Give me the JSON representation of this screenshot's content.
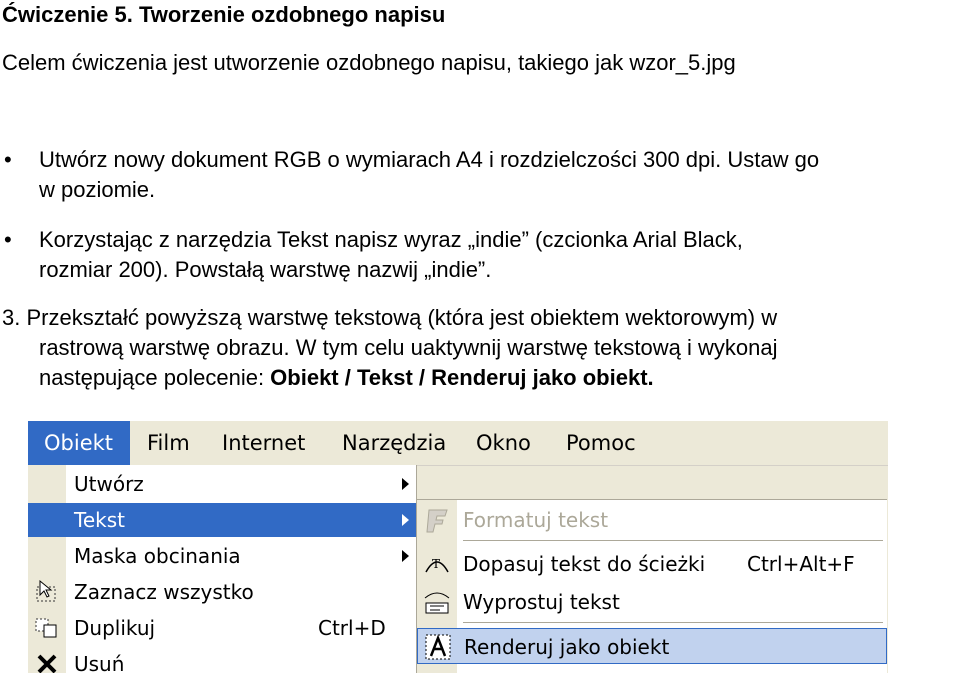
{
  "document": {
    "title": "Ćwiczenie 5. Tworzenie ozdobnego napisu",
    "intro": "Celem ćwiczenia jest utworzenie ozdobnego napisu, takiego jak wzor_5.jpg",
    "bullets": [
      {
        "line1": "Utwórz nowy dokument RGB o wymiarach A4 i rozdzielczości 300 dpi. Ustaw go",
        "line2": "w poziomie."
      },
      {
        "line1": "Korzystając z narzędzia Tekst napisz wyraz „indie” (czcionka Arial Black,",
        "line2": "rozmiar 200). Powstałą warstwę nazwij „indie”."
      }
    ],
    "bullet_char": "•",
    "step3": {
      "line1": "3. Przekształć powyższą warstwę tekstową (która jest obiektem wektorowym) w",
      "line2": "rastrową warstwę obrazu. W tym celu uaktywnij warstwę tekstową i wykonaj",
      "line3_prefix": "następujące polecenie: ",
      "line3_bold": "Obiekt / Tekst / Renderuj jako obiekt."
    }
  },
  "screenshot": {
    "menubar": [
      "Obiekt",
      "Film",
      "Internet",
      "Narzędzia",
      "Okno",
      "Pomoc"
    ],
    "menu_items": [
      {
        "label": "Utwórz",
        "has_submenu": true,
        "icon": ""
      },
      {
        "label": "Tekst",
        "has_submenu": true,
        "icon": ""
      },
      {
        "label": "Maska obcinania",
        "has_submenu": true,
        "icon": ""
      },
      {
        "label": "Zaznacz wszystko",
        "shortcut": "",
        "icon": "select-all-icon"
      },
      {
        "label": "Duplikuj",
        "shortcut": "Ctrl+D",
        "icon": "duplicate-icon"
      },
      {
        "label": "Usuń",
        "shortcut": "",
        "icon": "delete-icon"
      }
    ],
    "submenu_items": [
      {
        "label": "Formatuj tekst",
        "shortcut": "",
        "icon": "format-text-icon",
        "disabled": true
      },
      {
        "label": "Dopasuj tekst do ścieżki",
        "shortcut": "Ctrl+Alt+F",
        "icon": "text-path-icon"
      },
      {
        "label": "Wyprostuj tekst",
        "shortcut": "",
        "icon": "straighten-text-icon"
      },
      {
        "label": "Renderuj jako obiekt",
        "shortcut": "",
        "icon": "render-object-icon",
        "hover": true
      }
    ],
    "colors": {
      "highlight": "#316ac5",
      "menu_bg": "#ece9d8",
      "hover": "#c1d2ee",
      "disabled": "#aca899"
    }
  }
}
